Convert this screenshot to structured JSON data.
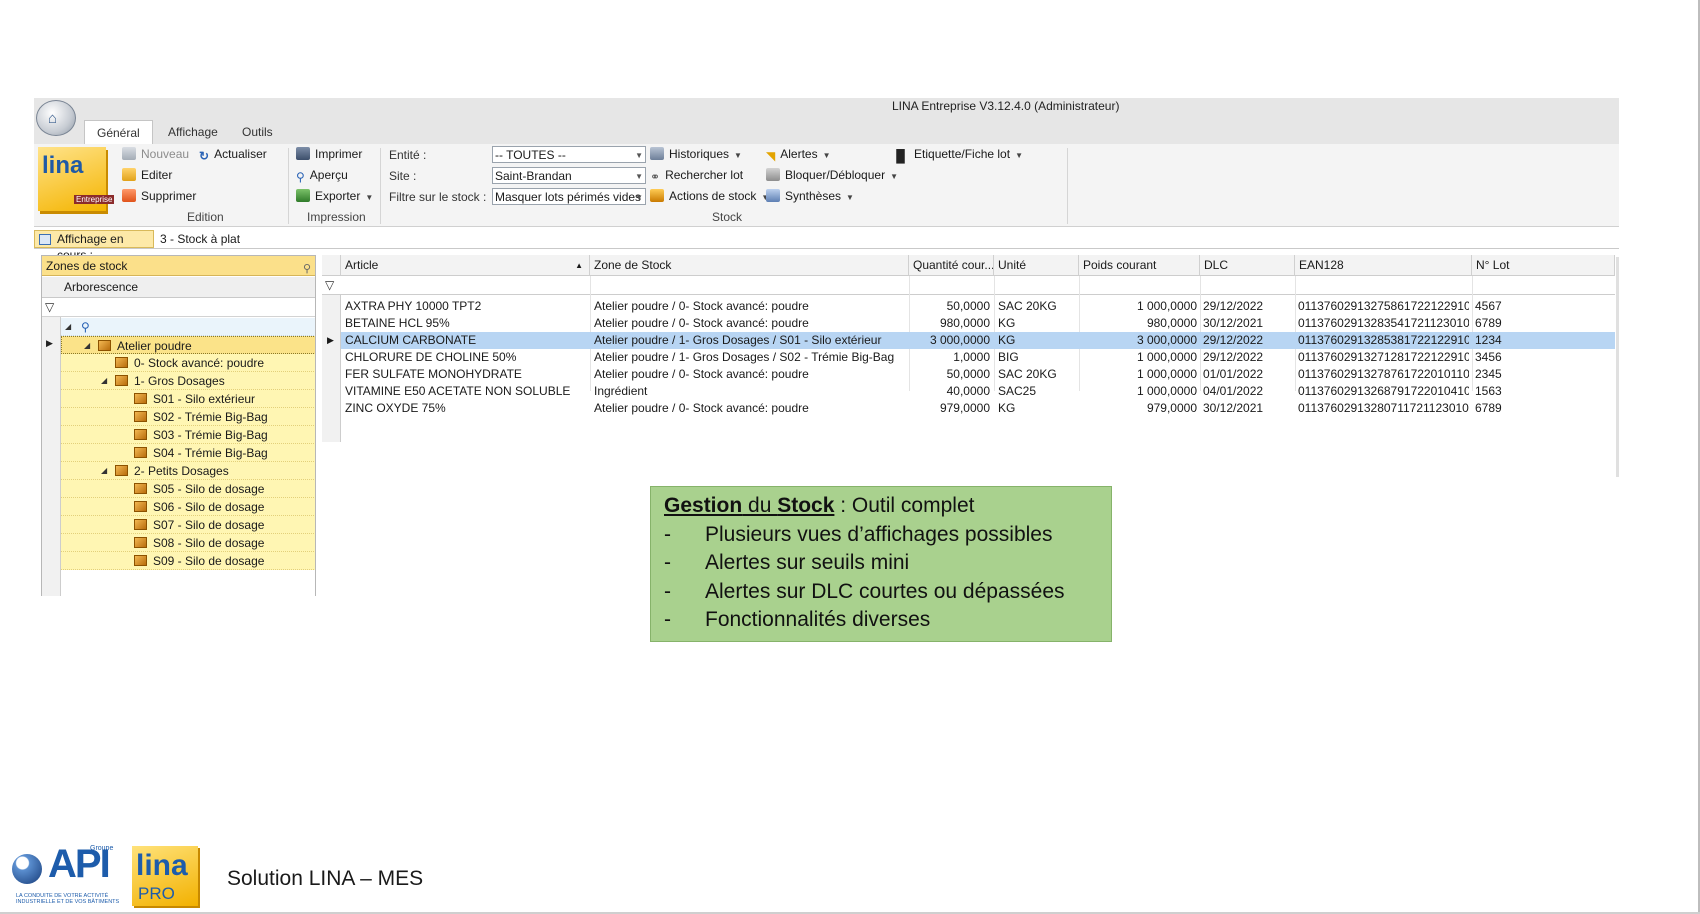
{
  "window": {
    "title": "LINA Entreprise  V3.12.4.0  (Administrateur)"
  },
  "tabs": [
    "Général",
    "Affichage",
    "Outils"
  ],
  "ribbon": {
    "logo_text": "lina",
    "logo_sub": "Entreprise",
    "edition": {
      "nouveau": "Nouveau",
      "actualiser": "Actualiser",
      "editer": "Editer",
      "supprimer": "Supprimer",
      "label": "Edition"
    },
    "impression": {
      "imprimer": "Imprimer",
      "apercu": "Aperçu",
      "exporter": "Exporter",
      "label": "Impression"
    },
    "filters": {
      "entite_label": "Entité :",
      "entite_value": "-- TOUTES --",
      "site_label": "Site :",
      "site_value": "Saint-Brandan",
      "filtre_label": "Filtre sur le stock :",
      "filtre_value": "Masquer lots périmés vides"
    },
    "stock": {
      "historiques": "Historiques",
      "rechercher": "Rechercher lot",
      "actions": "Actions de stock",
      "alertes": "Alertes",
      "bloquer": "Bloquer/Débloquer",
      "syntheses": "Synthèses",
      "label": "Stock"
    },
    "etiquette": "Etiquette/Fiche lot"
  },
  "infobar": {
    "label": "Affichage en cours :",
    "value": "3 - Stock à plat"
  },
  "tree": {
    "title": "Zones de stock",
    "column": "Arborescence",
    "items": [
      {
        "label": "Atelier poudre"
      },
      {
        "label": "0- Stock avancé: poudre"
      },
      {
        "label": "1- Gros Dosages"
      },
      {
        "label": "S01 - Silo extérieur"
      },
      {
        "label": "S02 - Trémie Big-Bag"
      },
      {
        "label": "S03 - Trémie Big-Bag"
      },
      {
        "label": "S04 - Trémie Big-Bag"
      },
      {
        "label": "2- Petits Dosages"
      },
      {
        "label": "S05 - Silo de dosage"
      },
      {
        "label": "S06 - Silo de dosage"
      },
      {
        "label": "S07 - Silo de dosage"
      },
      {
        "label": "S08 - Silo de dosage"
      },
      {
        "label": "S09 - Silo de dosage"
      }
    ]
  },
  "grid": {
    "columns": [
      "Article",
      "Zone de Stock",
      "Quantité cour...",
      "Unité",
      "Poids courant",
      "DLC",
      "EAN128",
      "N° Lot"
    ],
    "rows": [
      {
        "article": "AXTRA PHY 10000 TPT2",
        "zone": "Atelier poudre / 0- Stock avancé: poudre",
        "qte": "50,0000",
        "unite": "SAC 20KG",
        "poids": "1 000,0000",
        "dlc": "29/12/2022",
        "ean": "01137602913275861722122910...",
        "lot": "4567"
      },
      {
        "article": "BETAINE HCL 95%",
        "zone": "Atelier poudre / 0- Stock avancé: poudre",
        "qte": "980,0000",
        "unite": "KG",
        "poids": "980,0000",
        "dlc": "30/12/2021",
        "ean": "01137602913283541721123010...",
        "lot": "6789"
      },
      {
        "article": "CALCIUM CARBONATE",
        "zone": "Atelier poudre / 1- Gros Dosages / S01 - Silo extérieur",
        "qte": "3 000,0000",
        "unite": "KG",
        "poids": "3 000,0000",
        "dlc": "29/12/2022",
        "ean": "01137602913285381722122910...",
        "lot": "1234"
      },
      {
        "article": "CHLORURE DE CHOLINE 50%",
        "zone": "Atelier poudre / 1- Gros Dosages / S02 - Trémie Big-Bag",
        "qte": "1,0000",
        "unite": "BIG",
        "poids": "1 000,0000",
        "dlc": "29/12/2022",
        "ean": "01137602913271281722122910...",
        "lot": "3456"
      },
      {
        "article": "FER SULFATE MONOHYDRATE",
        "zone": "Atelier poudre / 0- Stock avancé: poudre",
        "qte": "50,0000",
        "unite": "SAC 20KG",
        "poids": "1 000,0000",
        "dlc": "01/01/2022",
        "ean": "01137602913278761722010110...",
        "lot": "2345"
      },
      {
        "article": "VITAMINE E50 ACETATE NON SOLUBLE",
        "zone": "Ingrédient",
        "qte": "40,0000",
        "unite": "SAC25",
        "poids": "1 000,0000",
        "dlc": "04/01/2022",
        "ean": "01137602913268791722010410...",
        "lot": "1563"
      },
      {
        "article": "ZINC OXYDE 75%",
        "zone": "Atelier poudre / 0- Stock avancé: poudre",
        "qte": "979,0000",
        "unite": "KG",
        "poids": "979,0000",
        "dlc": "30/12/2021",
        "ean": "01137602913280711721123010...",
        "lot": "6789"
      }
    ]
  },
  "callout": {
    "title_gestion": "Gestion",
    "title_du": " du ",
    "title_stock": "Stock",
    "title_rest": " : Outil complet",
    "dash": "-",
    "bullets": [
      "Plusieurs vues d’affichages possibles",
      "Alertes sur seuils mini",
      "Alertes sur DLC courtes ou dépassées",
      "Fonctionnalités diverses"
    ]
  },
  "footer": {
    "api_text": "API",
    "api_groupe": "Groupe",
    "api_sub": "LA CONDUITE DE VOTRE ACTIVITÉ INDUSTRIELLE ET DE VOS BÂTIMENTS",
    "linapro_lina": "lina",
    "linapro_pro": "PRO",
    "title": "Solution LINA – MES"
  }
}
